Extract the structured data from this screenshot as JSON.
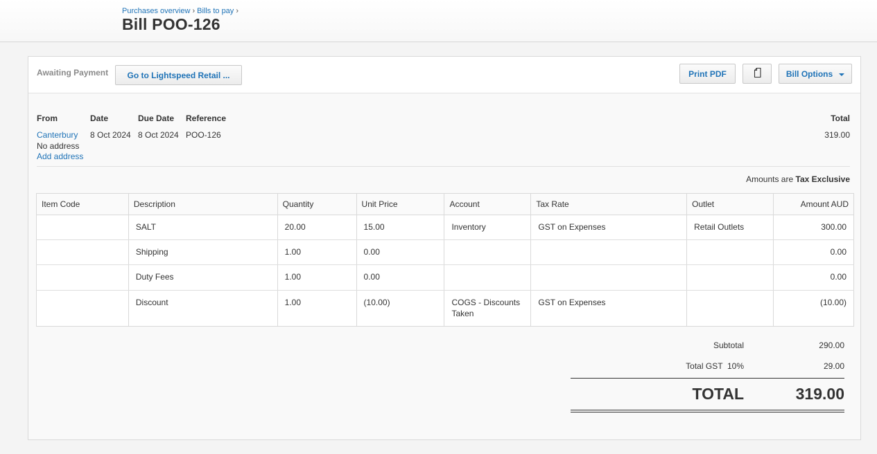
{
  "breadcrumb": {
    "item1": "Purchases overview",
    "item2": "Bills to pay",
    "sep": "›"
  },
  "page_title": "Bill POO-126",
  "header": {
    "status": "Awaiting Payment",
    "lightspeed_button": "Go to Lightspeed Retail ...",
    "print_button": "Print PDF",
    "copy_icon": "copy-icon",
    "options_button": "Bill Options"
  },
  "info": {
    "from_label": "From",
    "date_label": "Date",
    "due_label": "Due Date",
    "ref_label": "Reference",
    "total_label": "Total",
    "from_name": "Canterbury",
    "address": "No address",
    "add_address": "Add address",
    "date": "8 Oct 2024",
    "due_date": "8 Oct 2024",
    "reference": "POO-126",
    "total": "319.00"
  },
  "amounts_prefix": "Amounts are",
  "amounts_type": "Tax Exclusive",
  "columns": [
    "Item Code",
    "Description",
    "Quantity",
    "Unit Price",
    "Account",
    "Tax Rate",
    "Outlet",
    "Amount AUD"
  ],
  "rows": [
    {
      "code": "",
      "desc": "SALT",
      "qty": "20.00",
      "price": "15.00",
      "account": "Inventory",
      "tax": "GST on Expenses",
      "outlet": "Retail Outlets",
      "amount": "300.00"
    },
    {
      "code": "",
      "desc": "Shipping",
      "qty": "1.00",
      "price": "0.00",
      "account": "",
      "tax": "",
      "outlet": "",
      "amount": "0.00"
    },
    {
      "code": "",
      "desc": "Duty Fees",
      "qty": "1.00",
      "price": "0.00",
      "account": "",
      "tax": "",
      "outlet": "",
      "amount": "0.00"
    },
    {
      "code": "",
      "desc": "Discount",
      "qty": "1.00",
      "price": "(10.00)",
      "account": "COGS - Discounts Taken",
      "tax": "GST on Expenses",
      "outlet": "",
      "amount": "(10.00)"
    }
  ],
  "totals": {
    "subtotal_label": "Subtotal",
    "subtotal": "290.00",
    "gst_label": "Total GST  10%",
    "gst": "29.00",
    "total_label": "TOTAL",
    "total": "319.00"
  }
}
